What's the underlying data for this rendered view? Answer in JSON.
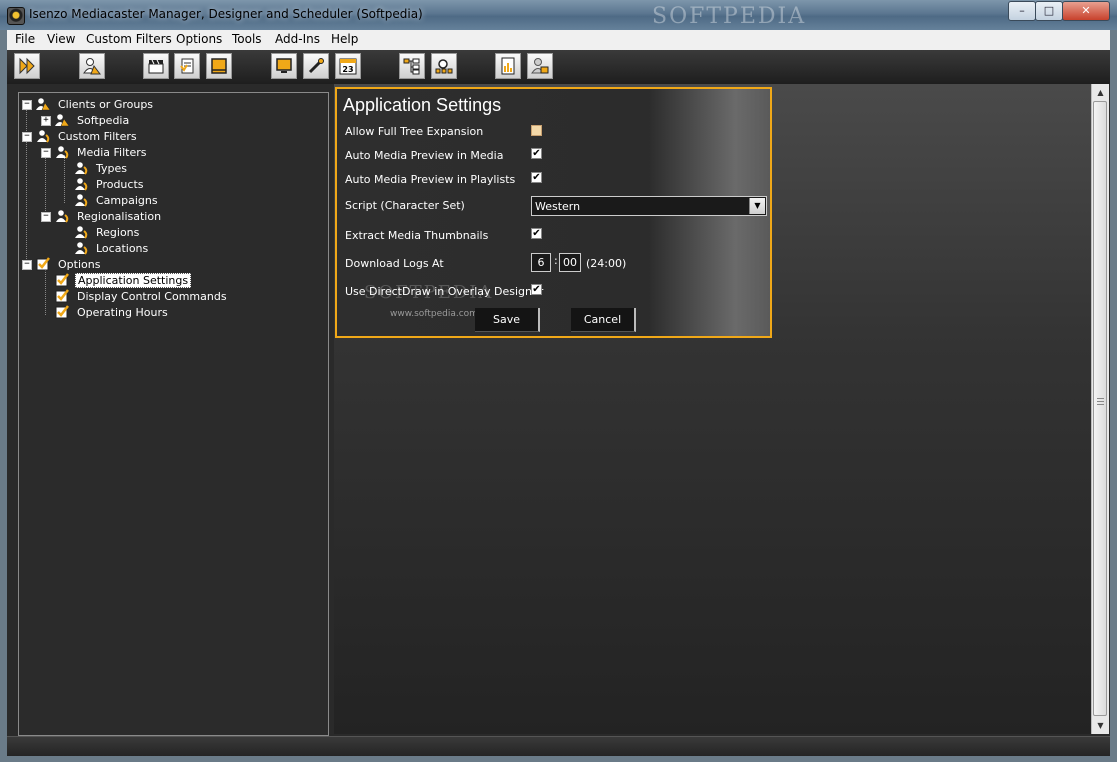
{
  "window": {
    "title": "Isenzo Mediacaster Manager, Designer and Scheduler (Softpedia)",
    "watermark": "SOFTPEDIA",
    "minimize_glyph": "–",
    "maximize_glyph": "□",
    "close_glyph": "✕"
  },
  "menu": [
    "File",
    "View",
    "Custom Filters",
    "Options",
    "Tools",
    "Add-Ins",
    "Help"
  ],
  "toolbar_icons": [
    "play-forward-icon",
    "user-icon",
    "clapperboard-icon",
    "document-icon",
    "layout-icon",
    "monitor-icon",
    "tools-icon",
    "calendar-icon",
    "tree-icon",
    "search-tree-icon",
    "report-icon",
    "user-lock-icon"
  ],
  "calendar_day": "23",
  "tree": {
    "clients_or_groups": "Clients or Groups",
    "softpedia": "Softpedia",
    "custom_filters": "Custom Filters",
    "media_filters": "Media Filters",
    "types": "Types",
    "products": "Products",
    "campaigns": "Campaigns",
    "regionalisation": "Regionalisation",
    "regions": "Regions",
    "locations": "Locations",
    "options": "Options",
    "application_settings": "Application Settings",
    "display_control_commands": "Display Control Commands",
    "operating_hours": "Operating Hours",
    "expand_glyph": "+",
    "collapse_glyph": "−"
  },
  "settings": {
    "title": "Application Settings",
    "allow_full_tree_expansion": "Allow Full Tree Expansion",
    "auto_media_preview_media": "Auto Media Preview in Media",
    "auto_media_preview_playlists": "Auto Media Preview in Playlists",
    "script_character_set": "Script (Character Set)",
    "script_value": "Western",
    "extract_media_thumbnails": "Extract Media Thumbnails",
    "download_logs_at": "Download Logs At",
    "download_hour": "6",
    "download_minute": "00",
    "colon": ":",
    "time_format_hint": "(24:00)",
    "use_directdraw": "Use DirectDraw in Overlay Designer",
    "check_glyph": "✔",
    "dropdown_glyph": "▼",
    "watermark": "SOFTPEDIA",
    "watermark_url": "www.softpedia.com",
    "save": "Save",
    "cancel": "Cancel"
  },
  "scrollbar": {
    "up_glyph": "▲",
    "down_glyph": "▼"
  },
  "colors": {
    "accent": "#f0a818",
    "panel": "#2b2b2b"
  }
}
